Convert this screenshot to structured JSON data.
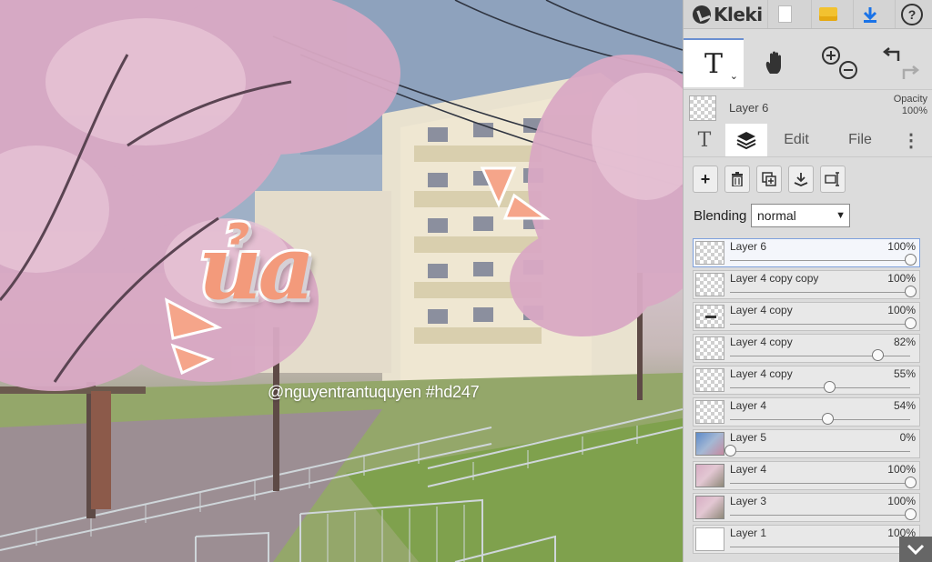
{
  "canvas": {
    "watermark": "@nguyentrantuquyen  #hd247",
    "title_word": "ủa"
  },
  "app": {
    "name": "Kleki",
    "top_buttons": [
      {
        "name": "new-image-icon"
      },
      {
        "name": "open-folder-icon"
      },
      {
        "name": "download-icon"
      },
      {
        "name": "help-icon",
        "label": "?"
      }
    ]
  },
  "tools": {
    "text_tool": "T",
    "hand_tool": "hand-icon",
    "zoom": "zoom-in-out-icon",
    "undo_redo": "undo-redo-icon"
  },
  "current_layer": {
    "name": "Layer 6",
    "opacity_label": "Opacity",
    "opacity_value": "100%"
  },
  "tabs": {
    "text": "T",
    "layers": "layers-icon",
    "edit": "Edit",
    "file": "File",
    "more": "⋮"
  },
  "blending": {
    "label": "Blending",
    "value": "normal"
  },
  "layers": [
    {
      "name": "Layer 6",
      "opacity": "100%",
      "level": 1.0,
      "selected": true,
      "thumb": "transparent"
    },
    {
      "name": "Layer 4 copy copy",
      "opacity": "100%",
      "level": 1.0,
      "selected": false,
      "thumb": "transparent"
    },
    {
      "name": "Layer 4 copy",
      "opacity": "100%",
      "level": 1.0,
      "selected": false,
      "thumb": "transparent-mark"
    },
    {
      "name": "Layer 4 copy",
      "opacity": "82%",
      "level": 0.82,
      "selected": false,
      "thumb": "transparent"
    },
    {
      "name": "Layer 4 copy",
      "opacity": "55%",
      "level": 0.55,
      "selected": false,
      "thumb": "transparent"
    },
    {
      "name": "Layer 4",
      "opacity": "54%",
      "level": 0.54,
      "selected": false,
      "thumb": "transparent"
    },
    {
      "name": "Layer 5",
      "opacity": "0%",
      "level": 0.0,
      "selected": false,
      "thumb": "photo-blue"
    },
    {
      "name": "Layer 4",
      "opacity": "100%",
      "level": 1.0,
      "selected": false,
      "thumb": "photo-pink"
    },
    {
      "name": "Layer 3",
      "opacity": "100%",
      "level": 1.0,
      "selected": false,
      "thumb": "photo-pink"
    },
    {
      "name": "Layer 1",
      "opacity": "100%",
      "level": 1.0,
      "selected": false,
      "thumb": "white"
    }
  ],
  "colors": {
    "accent": "#6a8fd1",
    "word_fill": "#f39a7b"
  }
}
